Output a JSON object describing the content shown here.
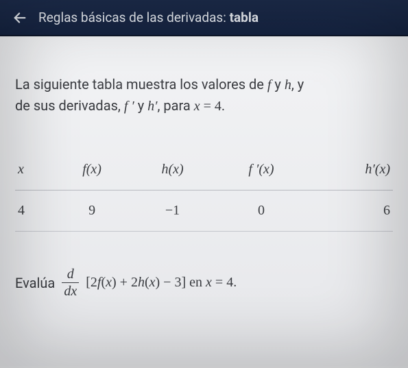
{
  "header": {
    "title_prefix": "Reglas básicas de las derivadas: ",
    "title_bold": "tabla"
  },
  "problem": {
    "line1_pre": "La siguiente tabla muestra los valores de ",
    "line1_f": "f",
    "line1_and": " y ",
    "line1_h": "h",
    "line1_post": ", y",
    "line2_pre": "de sus derivadas, ",
    "line2_fp": "f ′",
    "line2_and": " y ",
    "line2_hp": "h′",
    "line2_mid": ", para ",
    "line2_eq_lhs": "x",
    "line2_eq_op": " = ",
    "line2_eq_rhs": "4",
    "line2_end": "."
  },
  "table": {
    "headers": {
      "x": "x",
      "fx": "f(x)",
      "hx": "h(x)",
      "fpx": "f ′(x)",
      "hpx": "h′(x)"
    },
    "row": {
      "x": "4",
      "fx": "9",
      "hx": "−1",
      "fpx": "0",
      "hpx": "6"
    }
  },
  "eval": {
    "label": "Evalúa",
    "frac_num": "d",
    "frac_den": "dx",
    "expr_open": "[",
    "expr_body": "2f(x) + 2h(x) − 3",
    "expr_close": "]",
    "at_text": " en ",
    "at_var": "x",
    "at_op": " = ",
    "at_val": "4",
    "end": "."
  }
}
